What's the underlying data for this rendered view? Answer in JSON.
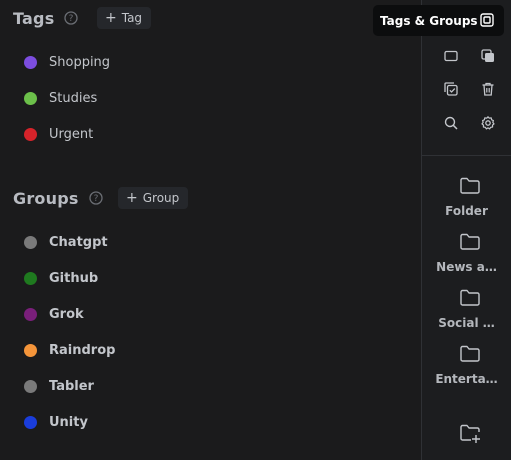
{
  "tags": {
    "title": "Tags",
    "add_label": "Tag",
    "items": [
      {
        "label": "Shopping",
        "color": "#7c4ddf"
      },
      {
        "label": "Studies",
        "color": "#6cc04a"
      },
      {
        "label": "Urgent",
        "color": "#d6232a"
      }
    ]
  },
  "groups": {
    "title": "Groups",
    "add_label": "Group",
    "items": [
      {
        "label": "Chatgpt",
        "color": "#7a7a7a"
      },
      {
        "label": "Github",
        "color": "#1f7a1f"
      },
      {
        "label": "Grok",
        "color": "#7a1f7a"
      },
      {
        "label": "Raindrop",
        "color": "#f5953a"
      },
      {
        "label": "Tabler",
        "color": "#7a7a7a"
      },
      {
        "label": "Unity",
        "color": "#1a3ddb"
      }
    ]
  },
  "tooltip": {
    "text": "Tags & Groups"
  },
  "sidebar": {
    "folders": [
      {
        "label": "Folder"
      },
      {
        "label": "News a…"
      },
      {
        "label": "Social …"
      },
      {
        "label": "Enterta…"
      }
    ]
  }
}
